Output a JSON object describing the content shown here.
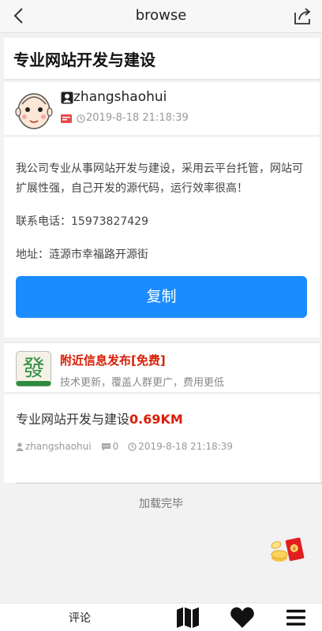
{
  "header": {
    "title": "browse"
  },
  "post": {
    "title": "专业网站开发与建设",
    "author": "zhangshaohui",
    "time": "2019-8-18 21:18:39",
    "content": "我公司专业从事网站开发与建设，采用云平台托管，网站可扩展性强，自己开发的源代码，运行效率很高！",
    "phone": "联系电话：15973827429",
    "address": "地址：涟源市幸福路开源街",
    "copy_label": "复制"
  },
  "ad": {
    "logo_char": "發",
    "title": "附近信息发布[免费]",
    "subtitle": "技术更新，覆盖人群更广，费用更低"
  },
  "nearby": {
    "title": "专业网站开发与建设",
    "distance": "0.69KM",
    "author": "zhangshaohui",
    "comments": "0",
    "time": "2019-8-18 21:18:39"
  },
  "list": {
    "end_text": "加载完毕"
  },
  "bottom_bar": {
    "comment_label": "评论"
  },
  "colors": {
    "accent": "#1a8cff",
    "highlight": "#d81e06"
  }
}
